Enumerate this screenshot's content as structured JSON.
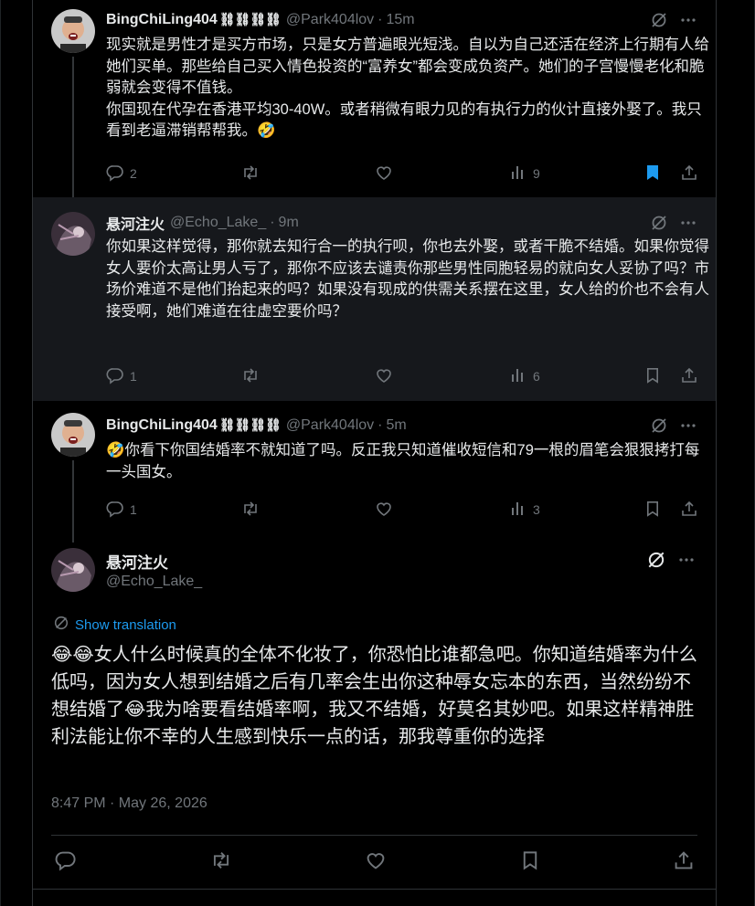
{
  "colors": {
    "accent": "#1d9bf0",
    "muted": "#71767b",
    "text": "#e7e9ea"
  },
  "tweets": [
    {
      "name": "BingChiLing404",
      "name_emoji": "⛓⛓⛓⛓",
      "handle": "@Park404lov",
      "time": "15m",
      "text": "现实就是男性才是买方市场，只是女方普遍眼光短浅。自以为自己还活在经济上行期有人给她们买单。那些给自己买入情色投资的“富养女”都会变成负资产。她们的子宫慢慢老化和脆弱就会变得不值钱。\n你国现在代孕在香港平均30-40W。或者稍微有眼力见的有执行力的伙计直接外娶了。我只看到老逼滞销帮帮我。🤣",
      "replies": "2",
      "views": "9",
      "bookmarked": true
    },
    {
      "name": "悬河注火",
      "handle": "@Echo_Lake_",
      "time": "9m",
      "text": "你如果这样觉得，那你就去知行合一的执行呗，你也去外娶，或者干脆不结婚。如果你觉得女人要价太高让男人亏了，那你不应该去谴责你那些男性同胞轻易的就向女人妥协了吗？市场价难道不是他们抬起来的吗？如果没有现成的供需关系摆在这里，女人给的价也不会有人接受啊，她们难道在往虚空要价吗？",
      "replies": "1",
      "views": "6"
    },
    {
      "name": "BingChiLing404",
      "name_emoji": "⛓⛓⛓⛓",
      "handle": "@Park404lov",
      "time": "5m",
      "text": "🤣你看下你国结婚率不就知道了吗。反正我只知道催收短信和79一根的眉笔会狠狠拷打每一头国女。",
      "replies": "1",
      "views": "3"
    }
  ],
  "focused": {
    "name": "悬河注火",
    "handle": "@Echo_Lake_",
    "translate_label": "Show translation",
    "text": "😂😂女人什么时候真的全体不化妆了，你恐怕比谁都急吧。你知道结婚率为什么低吗，因为女人想到结婚之后有几率会生出你这种辱女忘本的东西，当然纷纷不想结婚了😂我为啥要看结婚率啊，我又不结婚，好莫名其妙吧。如果这样精神胜利法能让你不幸的人生感到快乐一点的话，那我尊重你的选择",
    "timestamp": "8:47 PM · May 26, 2026"
  },
  "icons": {
    "reply": "reply-icon",
    "repost": "repost-icon",
    "like": "like-icon",
    "views": "views-icon",
    "bookmark": "bookmark-icon",
    "share": "share-icon",
    "grok": "grok-icon",
    "more": "more-icon",
    "translate": "translate-icon"
  }
}
